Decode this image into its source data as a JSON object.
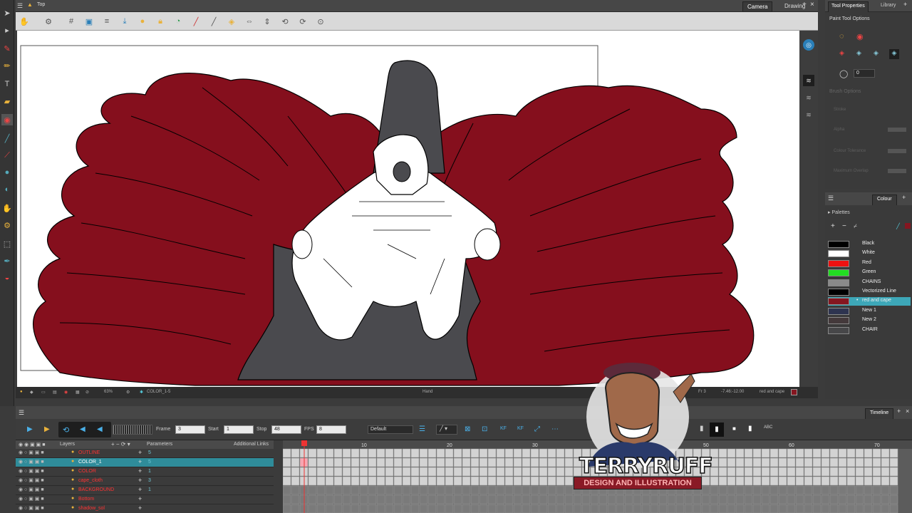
{
  "camera_view": {
    "title": "Top",
    "tabs": [
      "Camera",
      "Drawing"
    ],
    "status": {
      "zoom": "63%",
      "drawing": "COLOR_1-5",
      "tool": "Hand",
      "frame": "Fr 3",
      "coords": "-7.46:-12.00",
      "colour": "red and cape"
    }
  },
  "tool_properties": {
    "tabs": [
      "Tool Properties",
      "Library"
    ],
    "section": "Paint Tool Options",
    "rotation_value": "0",
    "disabled_section": "Brush Options",
    "options": [
      "Stroke",
      "Alpha",
      "Colour Tolerance",
      "Maximum Overlap"
    ]
  },
  "colour_panel": {
    "title": "Colour",
    "palettes_label": "Palettes",
    "swatches": [
      {
        "name": "Black",
        "color": "#000000"
      },
      {
        "name": "White",
        "color": "#ffffff"
      },
      {
        "name": "Red",
        "color": "#ee1111"
      },
      {
        "name": "Green",
        "color": "#22dd22"
      },
      {
        "name": "CHAINS",
        "color": "#8a8a8a"
      },
      {
        "name": "Vectorized Line",
        "color": "#000000"
      },
      {
        "name": "red and cape",
        "color": "#851620"
      },
      {
        "name": "New 1",
        "color": "#2e3450"
      },
      {
        "name": "New 2",
        "color": "#44393b"
      },
      {
        "name": "CHAIR",
        "color": "#474749"
      }
    ],
    "selected_index": 6
  },
  "timeline": {
    "title": "Timeline",
    "frame_label": "Frame",
    "frame_value": "3",
    "start_label": "Start",
    "start_value": "1",
    "stop_label": "Stop",
    "stop_value": "48",
    "fps_label": "FPS",
    "fps_value": "8",
    "preset": "Default",
    "headers": {
      "layers": "Layers",
      "parameters": "Parameters",
      "additional": "Additional Links"
    },
    "ruler": [
      "10",
      "20",
      "30",
      "50",
      "60",
      "70"
    ],
    "layers": [
      {
        "name": "OUTLINE",
        "param": "5"
      },
      {
        "name": "COLOR_1",
        "param": "5"
      },
      {
        "name": "COLOR",
        "param": "1"
      },
      {
        "name": "cape_cloth",
        "param": "3"
      },
      {
        "name": "BACKGROUND",
        "param": "1"
      },
      {
        "name": "Bottom",
        "param": ""
      },
      {
        "name": "shadow_sol",
        "param": ""
      }
    ],
    "selected_layer": 1
  },
  "watermark": {
    "name": "TERRYRUFF",
    "tagline": "DESIGN AND ILLUSTRATION"
  }
}
